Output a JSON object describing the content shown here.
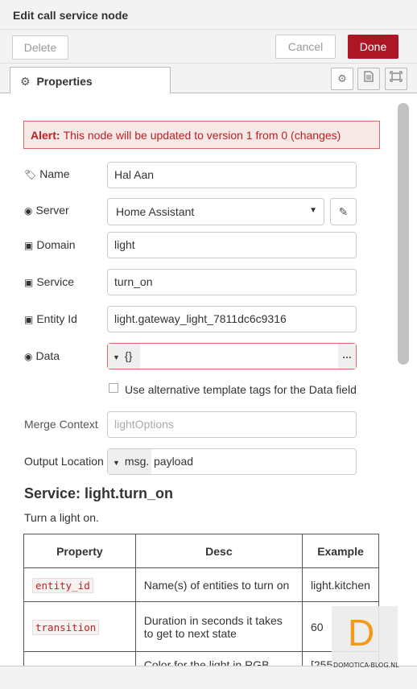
{
  "dialog": {
    "title": "Edit call service node"
  },
  "buttons": {
    "delete": "Delete",
    "cancel": "Cancel",
    "done": "Done"
  },
  "tabs": {
    "properties": "Properties"
  },
  "alert": {
    "label": "Alert:",
    "message": "This node will be updated to version 1 from 0 (changes)"
  },
  "form": {
    "name": {
      "label": "Name",
      "value": "Hal Aan"
    },
    "server": {
      "label": "Server",
      "value": "Home Assistant"
    },
    "domain": {
      "label": "Domain",
      "value": "light"
    },
    "service": {
      "label": "Service",
      "value": "turn_on"
    },
    "entity_id": {
      "label": "Entity Id",
      "value": "light.gateway_light_7811dc6c9316"
    },
    "data": {
      "label": "Data",
      "type": "{}",
      "value": ""
    },
    "alt_template": {
      "label": "Use alternative template tags for the Data field",
      "checked": false
    },
    "merge_context": {
      "label": "Merge Context",
      "placeholder": "lightOptions"
    },
    "output_location": {
      "label": "Output Location",
      "type": "msg.",
      "value": "payload"
    }
  },
  "service_info": {
    "title": "Service: light.turn_on",
    "description": "Turn a light on.",
    "headers": [
      "Property",
      "Desc",
      "Example"
    ],
    "rows": [
      {
        "property": "entity_id",
        "desc": "Name(s) of entities to turn on",
        "example": "light.kitchen"
      },
      {
        "property": "transition",
        "desc": "Duration in seconds it takes to get to next state",
        "example": "60"
      },
      {
        "property": "",
        "desc": "Color for the light in RGB",
        "example": "[255"
      }
    ]
  },
  "watermark": {
    "letter": "D",
    "text": "DOMOTICA-BLOG.NL"
  },
  "colors": {
    "done_button": "#ad1625",
    "alert_text": "#c02020",
    "alert_bg": "#f7e8e8",
    "logo": "#f29a18"
  }
}
